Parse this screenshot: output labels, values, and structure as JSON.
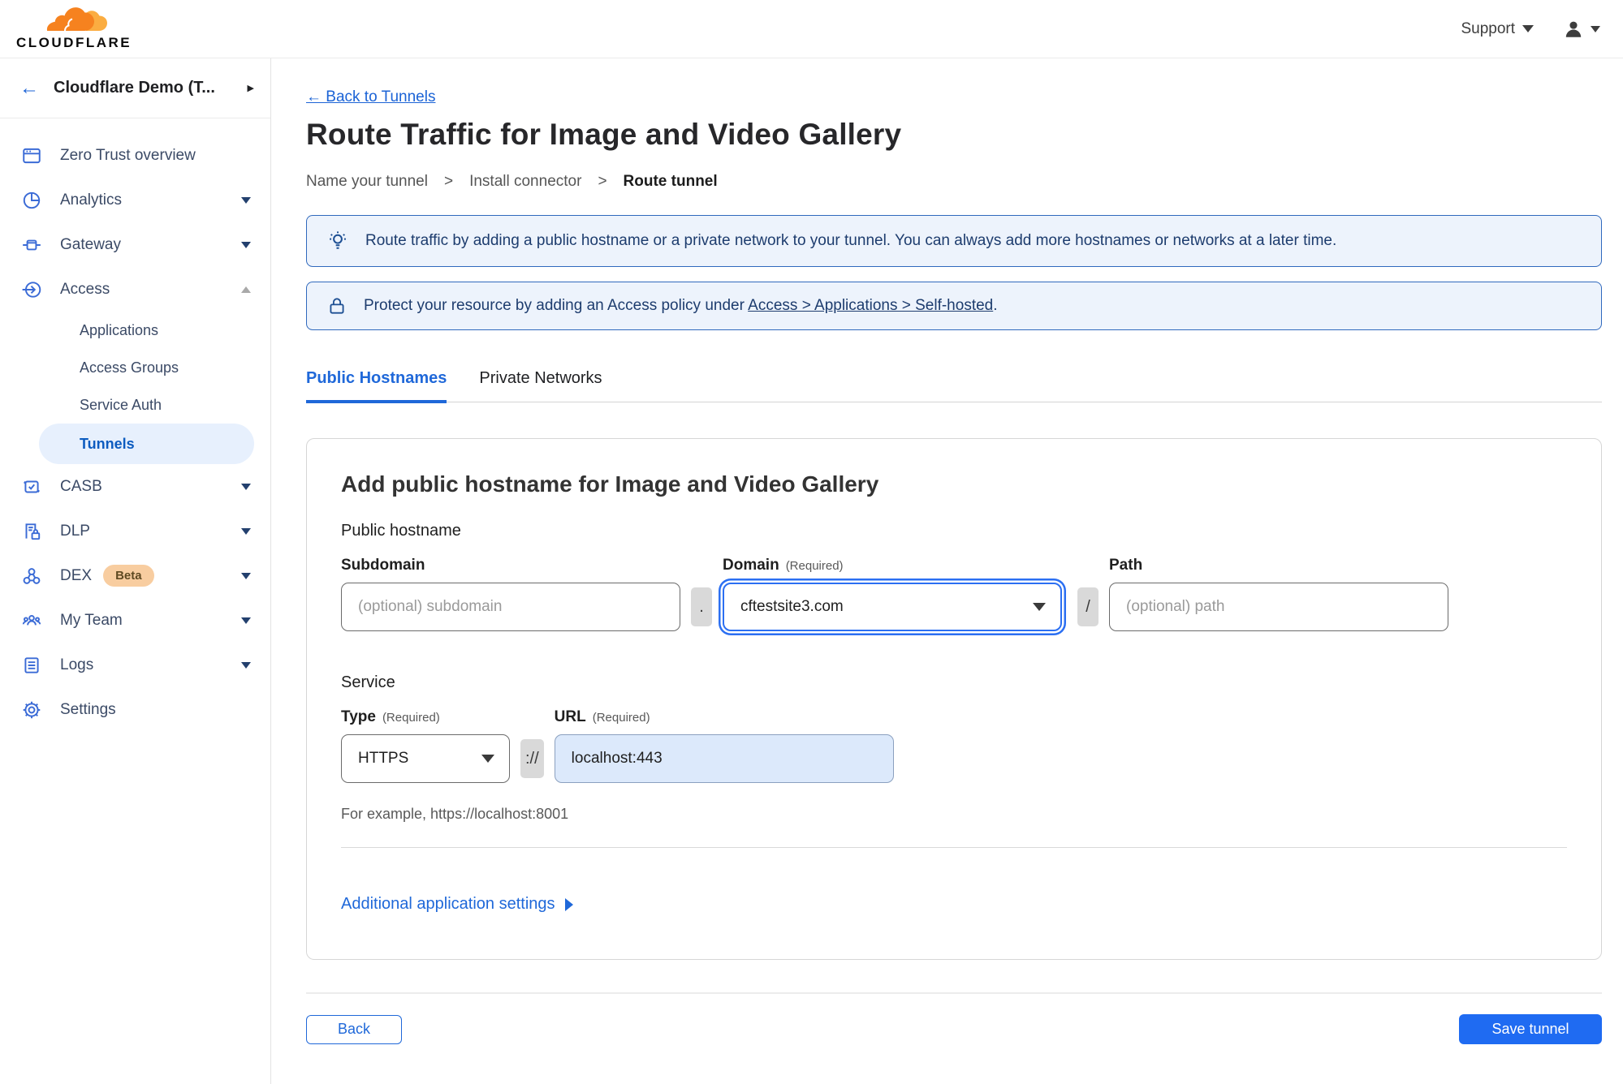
{
  "topbar": {
    "logo_text": "CLOUDFLARE",
    "support_label": "Support"
  },
  "sidebar": {
    "account_name": "Cloudflare Demo (T...",
    "items": [
      "Zero Trust overview",
      "Analytics",
      "Gateway",
      "Access",
      "CASB",
      "DLP",
      "DEX",
      "My Team",
      "Logs",
      "Settings"
    ],
    "access_children": [
      "Applications",
      "Access Groups",
      "Service Auth",
      "Tunnels"
    ],
    "active_item": "Tunnels",
    "dex_badge": "Beta"
  },
  "main": {
    "back_link": "← Back to Tunnels",
    "page_title": "Route Traffic for Image and Video Gallery",
    "steps": [
      "Name your tunnel",
      "Install connector",
      "Route tunnel"
    ],
    "step_separator": ">",
    "banner_tip": "Route traffic by adding a public hostname or a private network to your tunnel. You can always add more hostnames or networks at a later time.",
    "banner_protect_prefix": "Protect your resource by adding an Access policy under",
    "banner_protect_link": "Access > Applications > Self-hosted",
    "banner_protect_suffix": ".",
    "tabs": [
      "Public Hostnames",
      "Private Networks"
    ],
    "active_tab": "Public Hostnames"
  },
  "form": {
    "card_title": "Add public hostname for Image and Video Gallery",
    "public_hostname_label": "Public hostname",
    "subdomain": {
      "label": "Subdomain",
      "placeholder": "(optional) subdomain"
    },
    "dot_separator": ".",
    "domain": {
      "label": "Domain",
      "required_hint": "(Required)",
      "value": "cftestsite3.com"
    },
    "slash_separator": "/",
    "path": {
      "label": "Path",
      "placeholder": "(optional) path"
    },
    "service_label": "Service",
    "type": {
      "label": "Type",
      "required_hint": "(Required)",
      "value": "HTTPS"
    },
    "scheme_separator": "://",
    "url": {
      "label": "URL",
      "required_hint": "(Required)",
      "value": "localhost:443"
    },
    "example_text": "For example, https://localhost:8001",
    "additional_settings_label": "Additional application settings"
  },
  "footer": {
    "back_label": "Back",
    "save_label": "Save tunnel"
  },
  "icons": [
    "cloudflare-logo",
    "support-caret",
    "user-avatar",
    "back-arrow",
    "overview",
    "analytics",
    "gateway",
    "access",
    "casb",
    "dlp",
    "dex",
    "my-team",
    "logs",
    "settings",
    "lightbulb",
    "lock"
  ],
  "colors": {
    "accent_blue": "#1f6bf2",
    "link_blue": "#1b63d6",
    "tab_active_blue": "#1f68d9",
    "banner_bg": "#edf3fc",
    "banner_border": "#3069bd",
    "banner_text": "#1d3c6e",
    "sidebar_icon_blue": "#3b6bd6",
    "active_pill_bg": "#e7f0fd",
    "active_pill_text": "#0d5cc0",
    "beta_badge_bg": "#f8cda0",
    "url_field_bg": "#dce9fb",
    "focus_ring": "#2b6ff2"
  }
}
